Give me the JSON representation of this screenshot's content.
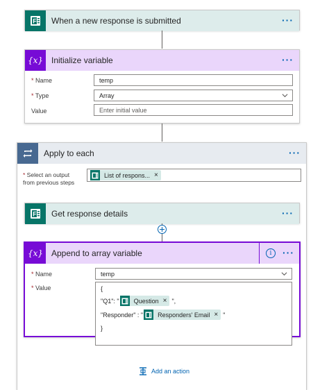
{
  "trigger": {
    "title": "When a new response is submitted",
    "icon": "forms-icon",
    "more_label": "···"
  },
  "init_var": {
    "title": "Initialize variable",
    "icon": "variable-icon",
    "more_label": "···",
    "name_label": "Name",
    "name_value": "temp",
    "type_label": "Type",
    "type_value": "Array",
    "value_label": "Value",
    "value_placeholder": "Enter initial value"
  },
  "apply_each": {
    "title": "Apply to each",
    "icon": "loop-icon",
    "more_label": "···",
    "select_label_1": "Select an output",
    "select_label_2": "from previous steps",
    "token_label": "List of respons...",
    "token_remove": "×"
  },
  "get_details": {
    "title": "Get response details",
    "icon": "forms-icon",
    "more_label": "···"
  },
  "append": {
    "title": "Append to array variable",
    "icon": "variable-icon",
    "info_label": "i",
    "more_label": "···",
    "name_label": "Name",
    "name_value": "temp",
    "value_label": "Value",
    "line_open": "{",
    "q1_key": "\"Q1\": \"",
    "q1_token": "Question",
    "q1_suffix": "\",",
    "resp_key": "\"Responder\" : \"",
    "resp_token": "Responders' Email",
    "resp_suffix": "\"",
    "line_close": "}",
    "token_remove": "×"
  },
  "add_action": {
    "label": "Add an action"
  },
  "colors": {
    "forms": "#077568",
    "variable": "#770bd6",
    "loop": "#486991",
    "accent": "#0063b1",
    "selected_border": "#770bd6"
  }
}
